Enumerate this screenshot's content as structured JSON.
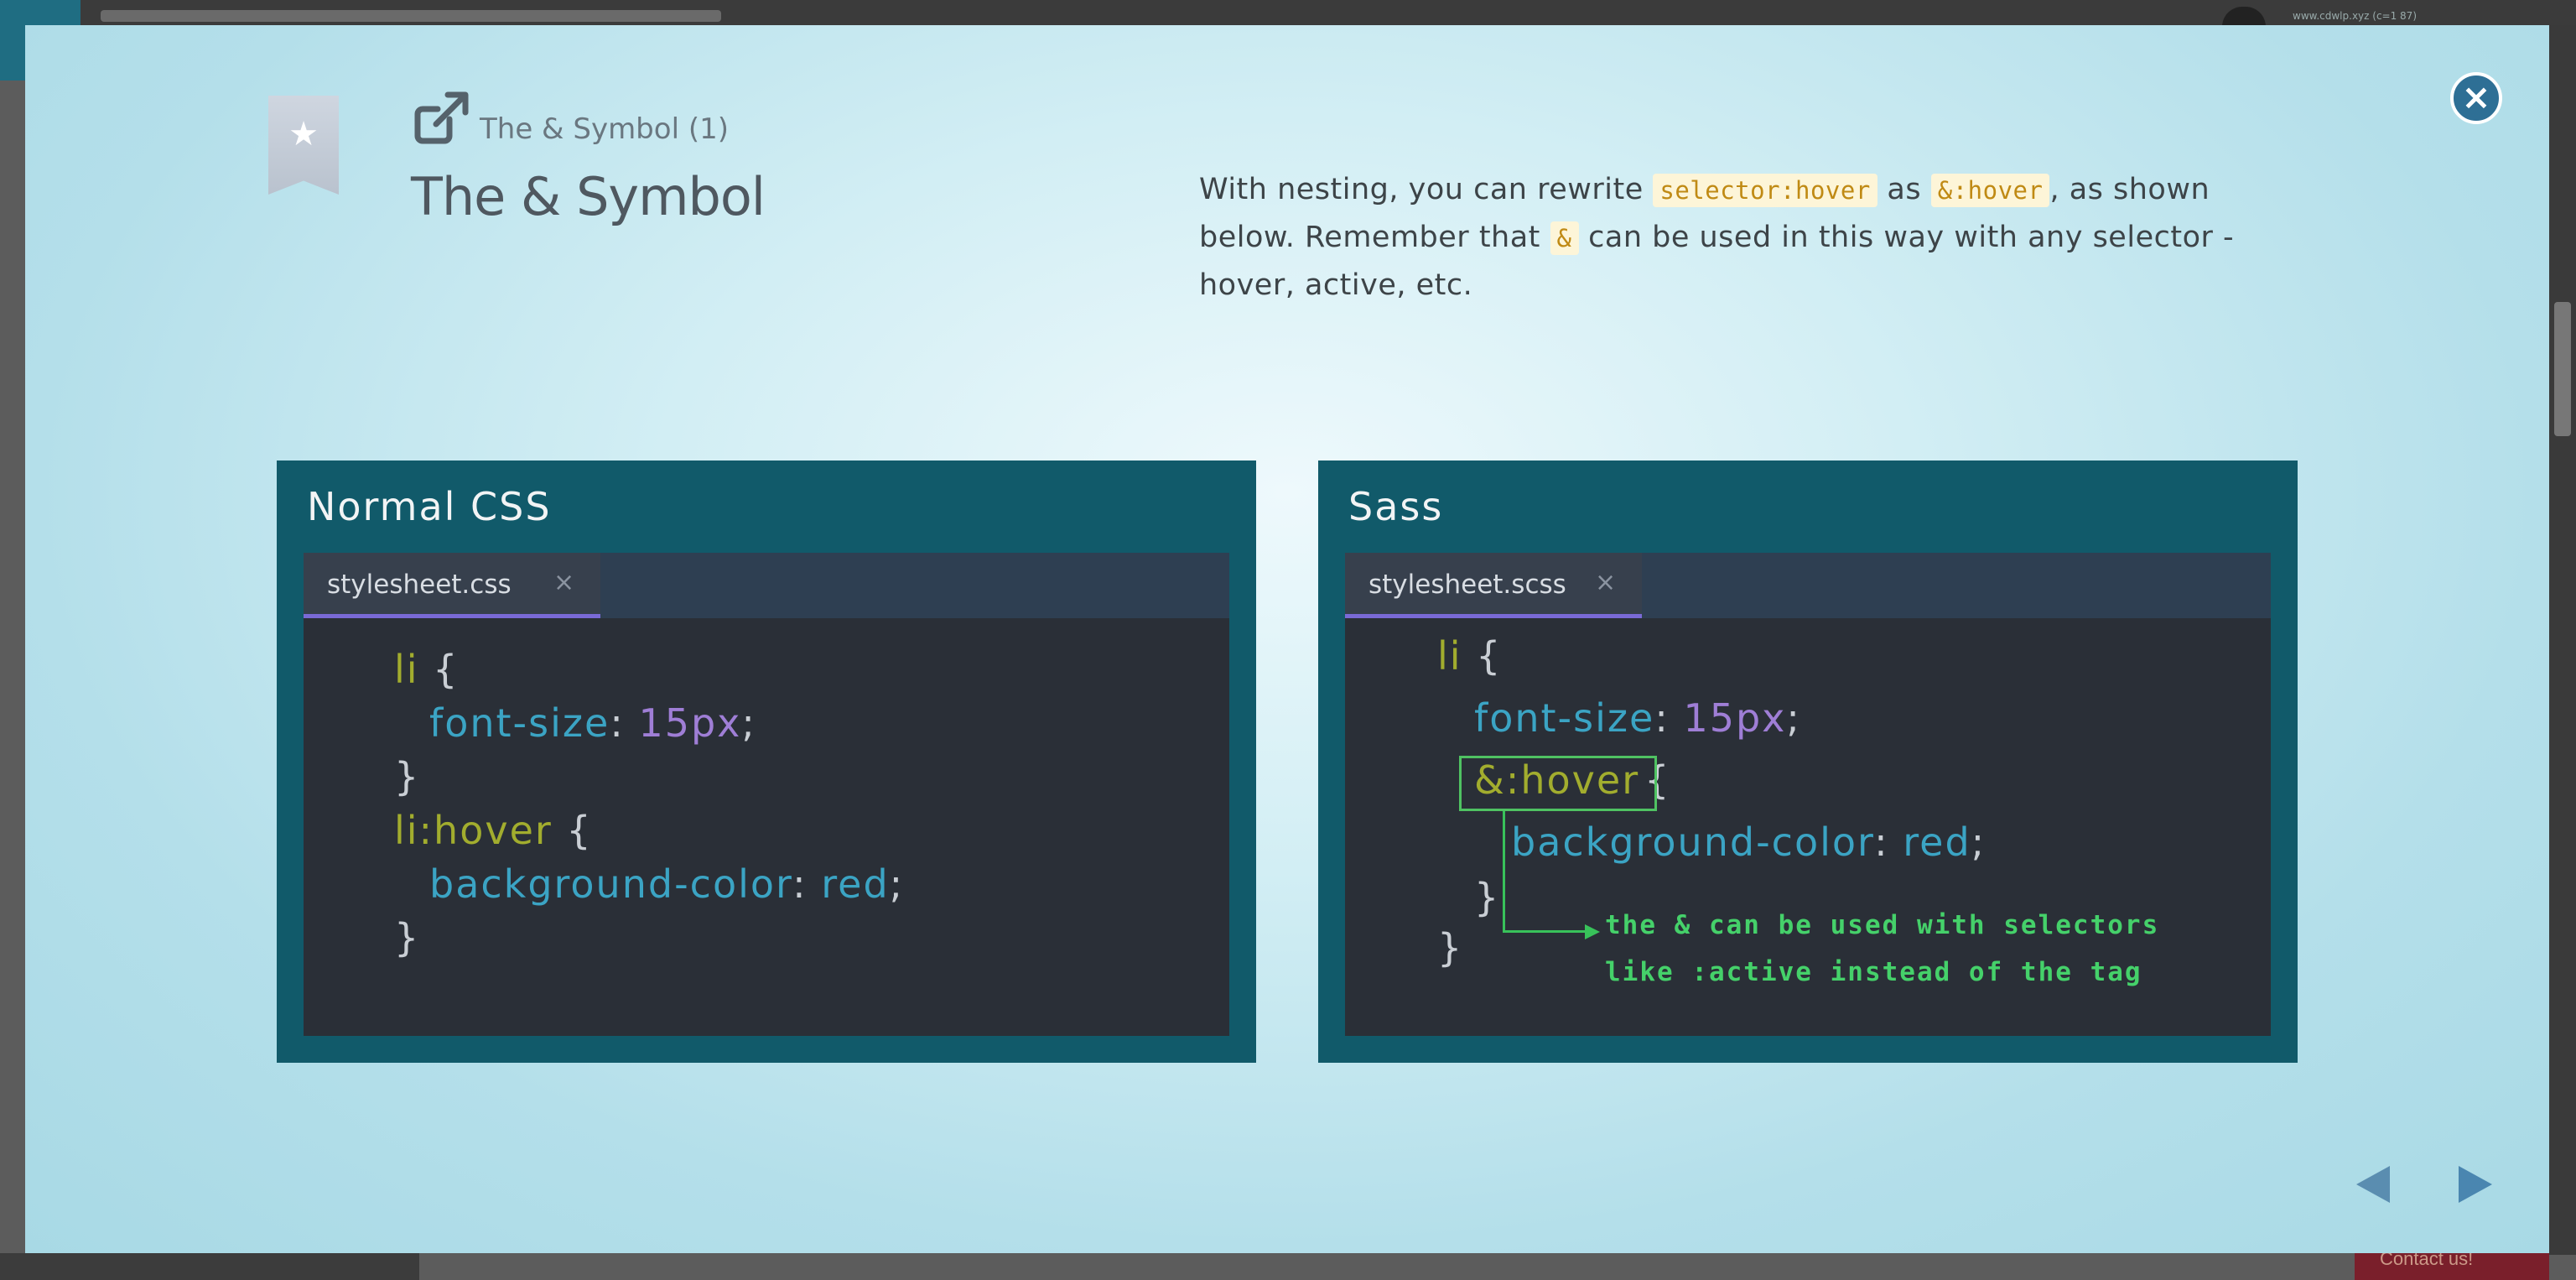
{
  "background": {
    "url_text": "www.cdwlp.xyz (c=1 87)",
    "contact_label": "Contact us!"
  },
  "modal": {
    "breadcrumb": "The & Symbol (1)",
    "title": "The & Symbol",
    "description": {
      "part1": "With nesting, you can rewrite ",
      "code1": "selector:hover",
      "part2": " as ",
      "code2": "&:hover",
      "part3": ", as shown below. Remember that ",
      "code3": "&",
      "part4": " can be used in this way with any selector - hover, active, etc."
    },
    "close_label": "×",
    "panels": {
      "css": {
        "title": "Normal CSS",
        "tab": "stylesheet.css",
        "tab_close": "×",
        "lines": {
          "l1_sel": "li",
          "l1_brace": " {",
          "l2_prop": "font-size",
          "l2_colon": ": ",
          "l2_val": "15px",
          "l2_semi": ";",
          "l3": "}",
          "l4_sel": "li:hover",
          "l4_brace": " {",
          "l5_prop": "background-color",
          "l5_colon": ": ",
          "l5_val": "red",
          "l5_semi": ";",
          "l6": "}"
        }
      },
      "sass": {
        "title": "Sass",
        "tab": "stylesheet.scss",
        "tab_close": "×",
        "lines": {
          "l1_sel": "li",
          "l1_brace": " {",
          "l2_prop": "font-size",
          "l2_colon": ": ",
          "l2_val": "15px",
          "l2_semi": ";",
          "l3_sel": "&:hover",
          "l3_brace": "{",
          "l4_prop": "background-color",
          "l4_colon": ": ",
          "l4_val": "red",
          "l4_semi": ";",
          "l5": "}",
          "l6": "}"
        },
        "annotation_line1": "the & can be used with selectors",
        "annotation_line2": "like :active instead of the tag"
      }
    }
  },
  "icons": {
    "bookmark": "bookmark-icon",
    "star": "star-icon",
    "external_link": "external-link-icon",
    "close": "close-icon",
    "prev": "triangle-left-icon",
    "next": "triangle-right-icon"
  },
  "colors": {
    "panel_bg": "#115a6a",
    "editor_bg": "#2a2f37",
    "selector": "#a2ad2e",
    "property": "#3ba4c4",
    "number": "#9f7ed6",
    "annotation": "#45d16a",
    "close_button": "#2e6f95"
  }
}
